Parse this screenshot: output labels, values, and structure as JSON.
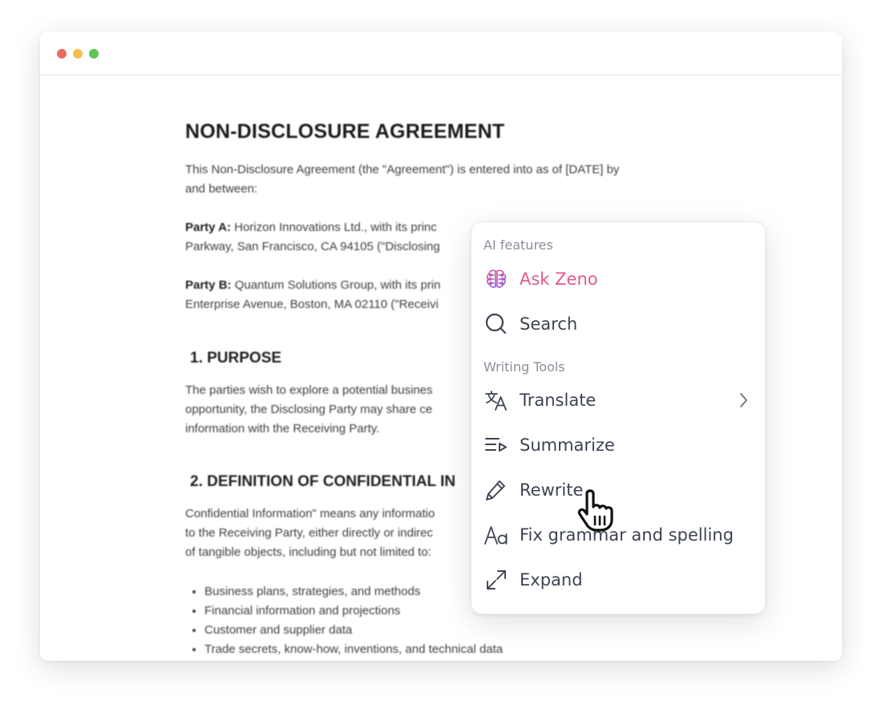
{
  "window": {
    "traffic_lights": [
      "close",
      "minimize",
      "zoom"
    ]
  },
  "document": {
    "title": "NON-DISCLOSURE AGREEMENT",
    "intro_line1": "This Non-Disclosure Agreement (the \"Agreement\") is entered into as of [DATE] by",
    "intro_line2": "and between:",
    "party_a_label": "Party A:",
    "party_a_line1": " Horizon Innovations Ltd., with its princ",
    "party_a_line2": "Parkway, San Francisco, CA 94105 (\"Disclosing",
    "party_b_label": "Party B:",
    "party_b_line1": " Quantum Solutions Group, with its prin",
    "party_b_line2": "Enterprise Avenue, Boston, MA 02110 (\"Receivi",
    "section1_heading": "1. PURPOSE",
    "section1_line1": "The parties wish to explore a potential busines",
    "section1_line2": "opportunity, the Disclosing Party may share ce",
    "section1_line3": "information with the Receiving Party.",
    "section2_heading": "2. DEFINITION OF CONFIDENTIAL IN",
    "section2_line1": "Confidential Information\" means any informatio",
    "section2_line2": "to the Receiving Party, either directly or indirec",
    "section2_line3": "of tangible objects, including but not limited to:",
    "bullets": [
      "Business plans, strategies, and methods",
      "Financial information and projections",
      "Customer and supplier data",
      "Trade secrets, know-how, inventions, and technical data"
    ]
  },
  "menu": {
    "ai_section_label": "AI features",
    "ask_zeno": {
      "label": "Ask Zeno",
      "icon": "brain-icon",
      "color": "#e05a8d"
    },
    "search": {
      "label": "Search",
      "icon": "search-icon"
    },
    "writing_section_label": "Writing Tools",
    "translate": {
      "label": "Translate",
      "icon": "translate-icon",
      "has_submenu": true
    },
    "summarize": {
      "label": "Summarize",
      "icon": "summarize-icon"
    },
    "rewrite": {
      "label": "Rewrite",
      "icon": "pencil-icon"
    },
    "fix_grammar": {
      "label": "Fix grammar and spelling",
      "icon": "font-aa-icon"
    },
    "expand": {
      "label": "Expand",
      "icon": "expand-arrows-icon"
    }
  },
  "colors": {
    "menu_text": "#3c4351",
    "section_label": "#8d8d9a",
    "accent_pink": "#e05a8d",
    "accent_purple": "#8b5cf6"
  }
}
